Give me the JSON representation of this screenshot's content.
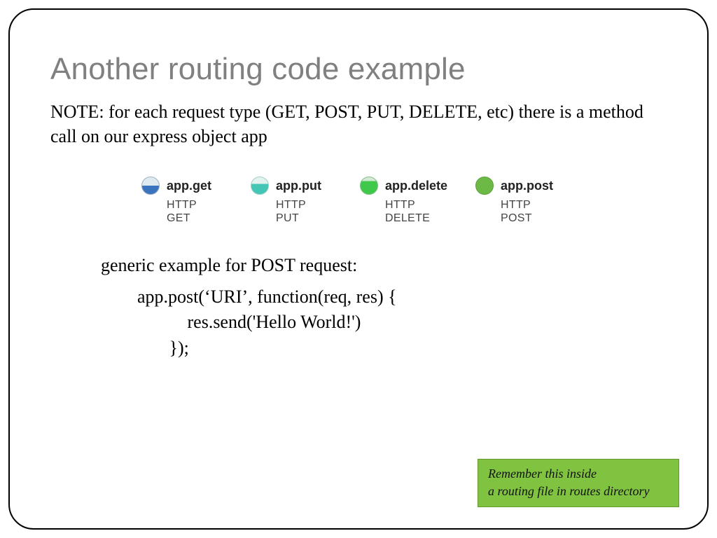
{
  "title": "Another routing code example",
  "note": "NOTE: for each request type (GET, POST, PUT, DELETE, etc) there is a method call on our express object app",
  "methods": [
    {
      "name": "app.get",
      "http": "HTTP GET"
    },
    {
      "name": "app.put",
      "http": "HTTP PUT"
    },
    {
      "name": "app.delete",
      "http": "HTTP DELETE"
    },
    {
      "name": "app.post",
      "http": "HTTP POST"
    }
  ],
  "example": {
    "intro": "generic example for POST request:",
    "line1": "app.post(‘URI’, function(req, res) {",
    "line2": "           res.send('Hello World!')",
    "line3": "       });"
  },
  "callout": {
    "line1": "Remember this inside",
    "line2": "a routing file in routes directory"
  }
}
